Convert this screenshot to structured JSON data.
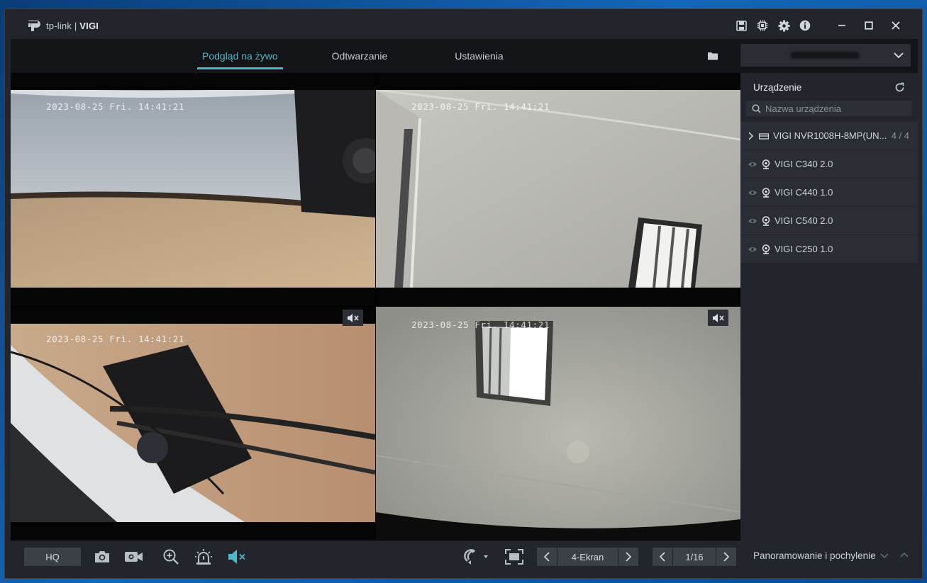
{
  "app": {
    "logo_brand": "tp-link",
    "logo_product": "VIGI"
  },
  "nav": {
    "tabs": [
      {
        "label": "Podgląd na żywo",
        "active": true
      },
      {
        "label": "Odtwarzanie",
        "active": false
      },
      {
        "label": "Ustawienia",
        "active": false
      }
    ]
  },
  "sidebar": {
    "title": "Urządzenie",
    "search_placeholder": "Nazwa urządzenia",
    "nvr": {
      "name": "VIGI NVR1008H-8MP(UN...",
      "count": "4 / 4"
    },
    "cameras": [
      {
        "name": "VIGI C340 2.0"
      },
      {
        "name": "VIGI C440 1.0"
      },
      {
        "name": "VIGI C540 2.0"
      },
      {
        "name": "VIGI C250 1.0"
      }
    ]
  },
  "feeds": [
    {
      "timestamp": "2023-08-25 Fri. 14:41:21",
      "muted_icon": false
    },
    {
      "timestamp": "2023-08-25 Fri. 14:41:21",
      "muted_icon": false
    },
    {
      "timestamp": "2023-08-25 Fri. 14:41:21",
      "muted_icon": true
    },
    {
      "timestamp": "2023-08-25 Fri. 14:41:21",
      "muted_icon": true
    }
  ],
  "bottom": {
    "quality_label": "HQ",
    "layout_label": "4-Ekran",
    "page_label": "1/16",
    "ptz_label": "Panoramowanie i pochylenie"
  },
  "colors": {
    "accent": "#4fb7c8",
    "window_bg": "#22262c",
    "nav_bg": "#121417"
  }
}
